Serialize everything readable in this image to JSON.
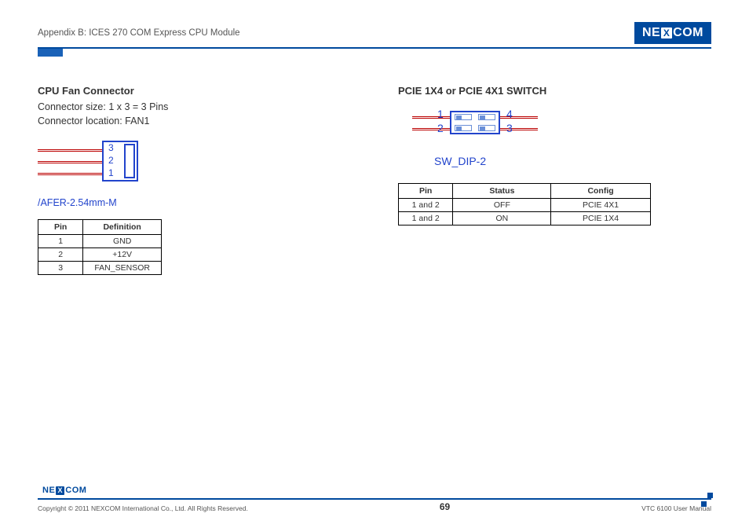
{
  "header": {
    "appendix": "Appendix B: ICES 270 COM Express CPU Module",
    "brand_pre": "NE",
    "brand_mid": "X",
    "brand_post": "COM"
  },
  "left": {
    "title": "CPU Fan Connector",
    "size_line": "Connector size: 1 x 3 = 3 Pins",
    "loc_line": "Connector location: FAN1",
    "pin3": "3",
    "pin2": "2",
    "pin1": "1",
    "diagram_label": "/AFER-2.54mm-M",
    "th_pin": "Pin",
    "th_def": "Definition",
    "rows": [
      {
        "pin": "1",
        "def": "GND"
      },
      {
        "pin": "2",
        "def": "+12V"
      },
      {
        "pin": "3",
        "def": "FAN_SENSOR"
      }
    ]
  },
  "right": {
    "title": "PCIE 1X4 or PCIE 4X1 SWITCH",
    "n1": "1",
    "n2": "2",
    "n3": "3",
    "n4": "4",
    "diagram_label": "SW_DIP-2",
    "th_pin": "Pin",
    "th_status": "Status",
    "th_config": "Config",
    "rows": [
      {
        "pin": "1 and 2",
        "status": "OFF",
        "config": "PCIE 4X1"
      },
      {
        "pin": "1 and 2",
        "status": "ON",
        "config": "PCIE 1X4"
      }
    ]
  },
  "footer": {
    "copyright": "Copyright © 2011 NEXCOM International Co., Ltd. All Rights Reserved.",
    "page": "69",
    "doc": "VTC 6100 User Manual"
  },
  "chart_data": [
    {
      "type": "table",
      "title": "CPU Fan Connector Pinout",
      "columns": [
        "Pin",
        "Definition"
      ],
      "rows": [
        [
          "1",
          "GND"
        ],
        [
          "2",
          "+12V"
        ],
        [
          "3",
          "FAN_SENSOR"
        ]
      ]
    },
    {
      "type": "table",
      "title": "PCIE 1X4 / 4X1 DIP Switch Config",
      "columns": [
        "Pin",
        "Status",
        "Config"
      ],
      "rows": [
        [
          "1 and 2",
          "OFF",
          "PCIE 4X1"
        ],
        [
          "1 and 2",
          "ON",
          "PCIE 1X4"
        ]
      ]
    }
  ]
}
